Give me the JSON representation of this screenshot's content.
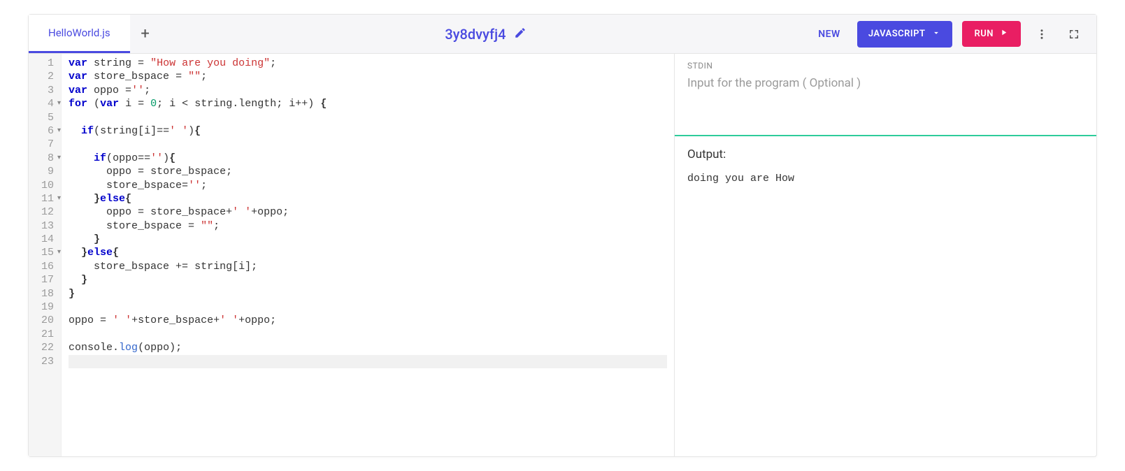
{
  "header": {
    "tabs": [
      {
        "label": "HelloWorld.js",
        "active": true
      }
    ],
    "project_id": "3y8dvyfj4",
    "new_label": "NEW",
    "language_label": "JAVASCRIPT",
    "run_label": "RUN"
  },
  "editor": {
    "lines": [
      {
        "n": 1,
        "fold": false,
        "tokens": [
          [
            "kw",
            "var"
          ],
          [
            "op",
            " string "
          ],
          [
            "op",
            "="
          ],
          [
            "op",
            " "
          ],
          [
            "str",
            "\"How are you doing\""
          ],
          [
            "punc",
            ";"
          ]
        ]
      },
      {
        "n": 2,
        "fold": false,
        "tokens": [
          [
            "kw",
            "var"
          ],
          [
            "op",
            " store_bspace "
          ],
          [
            "op",
            "="
          ],
          [
            "op",
            " "
          ],
          [
            "str",
            "\"\""
          ],
          [
            "punc",
            ";"
          ]
        ]
      },
      {
        "n": 3,
        "fold": false,
        "tokens": [
          [
            "kw",
            "var"
          ],
          [
            "op",
            " oppo "
          ],
          [
            "op",
            "="
          ],
          [
            "str",
            "''"
          ],
          [
            "punc",
            ";"
          ]
        ]
      },
      {
        "n": 4,
        "fold": true,
        "tokens": [
          [
            "kw",
            "for"
          ],
          [
            "op",
            " "
          ],
          [
            "punc",
            "("
          ],
          [
            "kw",
            "var"
          ],
          [
            "op",
            " i "
          ],
          [
            "op",
            "="
          ],
          [
            "op",
            " "
          ],
          [
            "num",
            "0"
          ],
          [
            "punc",
            ";"
          ],
          [
            "op",
            " i "
          ],
          [
            "op",
            "<"
          ],
          [
            "op",
            " string"
          ],
          [
            "punc",
            "."
          ],
          [
            "op",
            "length"
          ],
          [
            "punc",
            ";"
          ],
          [
            "op",
            " i"
          ],
          [
            "op",
            "++"
          ],
          [
            "punc",
            ")"
          ],
          [
            "op",
            " "
          ],
          [
            "bold",
            "{"
          ]
        ]
      },
      {
        "n": 5,
        "fold": false,
        "tokens": []
      },
      {
        "n": 6,
        "fold": true,
        "tokens": [
          [
            "op",
            "  "
          ],
          [
            "kw",
            "if"
          ],
          [
            "punc",
            "("
          ],
          [
            "op",
            "string"
          ],
          [
            "punc",
            "["
          ],
          [
            "op",
            "i"
          ],
          [
            "punc",
            "]"
          ],
          [
            "op",
            "=="
          ],
          [
            "str",
            "' '"
          ],
          [
            "punc",
            ")"
          ],
          [
            "bold",
            "{"
          ]
        ]
      },
      {
        "n": 7,
        "fold": false,
        "tokens": []
      },
      {
        "n": 8,
        "fold": true,
        "tokens": [
          [
            "op",
            "    "
          ],
          [
            "kw",
            "if"
          ],
          [
            "punc",
            "("
          ],
          [
            "op",
            "oppo"
          ],
          [
            "op",
            "=="
          ],
          [
            "str",
            "''"
          ],
          [
            "punc",
            ")"
          ],
          [
            "bold",
            "{"
          ]
        ]
      },
      {
        "n": 9,
        "fold": false,
        "tokens": [
          [
            "op",
            "      oppo "
          ],
          [
            "op",
            "="
          ],
          [
            "op",
            " store_bspace"
          ],
          [
            "punc",
            ";"
          ]
        ]
      },
      {
        "n": 10,
        "fold": false,
        "tokens": [
          [
            "op",
            "      store_bspace"
          ],
          [
            "op",
            "="
          ],
          [
            "str",
            "''"
          ],
          [
            "punc",
            ";"
          ]
        ]
      },
      {
        "n": 11,
        "fold": true,
        "tokens": [
          [
            "op",
            "    "
          ],
          [
            "bold",
            "}"
          ],
          [
            "kw",
            "else"
          ],
          [
            "bold",
            "{"
          ]
        ]
      },
      {
        "n": 12,
        "fold": false,
        "tokens": [
          [
            "op",
            "      oppo "
          ],
          [
            "op",
            "="
          ],
          [
            "op",
            " store_bspace"
          ],
          [
            "op",
            "+"
          ],
          [
            "str",
            "' '"
          ],
          [
            "op",
            "+oppo"
          ],
          [
            "punc",
            ";"
          ]
        ]
      },
      {
        "n": 13,
        "fold": false,
        "tokens": [
          [
            "op",
            "      store_bspace "
          ],
          [
            "op",
            "="
          ],
          [
            "op",
            " "
          ],
          [
            "str",
            "\"\""
          ],
          [
            "punc",
            ";"
          ]
        ]
      },
      {
        "n": 14,
        "fold": false,
        "tokens": [
          [
            "op",
            "    "
          ],
          [
            "bold",
            "}"
          ]
        ]
      },
      {
        "n": 15,
        "fold": true,
        "tokens": [
          [
            "op",
            "  "
          ],
          [
            "bold",
            "}"
          ],
          [
            "kw",
            "else"
          ],
          [
            "bold",
            "{"
          ]
        ]
      },
      {
        "n": 16,
        "fold": false,
        "tokens": [
          [
            "op",
            "    store_bspace "
          ],
          [
            "op",
            "+="
          ],
          [
            "op",
            " string"
          ],
          [
            "punc",
            "["
          ],
          [
            "op",
            "i"
          ],
          [
            "punc",
            "]"
          ],
          [
            "punc",
            ";"
          ]
        ]
      },
      {
        "n": 17,
        "fold": false,
        "tokens": [
          [
            "op",
            "  "
          ],
          [
            "bold",
            "}"
          ]
        ]
      },
      {
        "n": 18,
        "fold": false,
        "tokens": [
          [
            "bold",
            "}"
          ]
        ]
      },
      {
        "n": 19,
        "fold": false,
        "tokens": []
      },
      {
        "n": 20,
        "fold": false,
        "tokens": [
          [
            "op",
            "oppo "
          ],
          [
            "op",
            "="
          ],
          [
            "op",
            " "
          ],
          [
            "str",
            "' '"
          ],
          [
            "op",
            "+store_bspace"
          ],
          [
            "op",
            "+"
          ],
          [
            "str",
            "' '"
          ],
          [
            "op",
            "+oppo"
          ],
          [
            "punc",
            ";"
          ]
        ]
      },
      {
        "n": 21,
        "fold": false,
        "tokens": []
      },
      {
        "n": 22,
        "fold": false,
        "tokens": [
          [
            "op",
            "console"
          ],
          [
            "punc",
            "."
          ],
          [
            "fn",
            "log"
          ],
          [
            "punc",
            "("
          ],
          [
            "op",
            "oppo"
          ],
          [
            "punc",
            ")"
          ],
          [
            "punc",
            ";"
          ]
        ]
      },
      {
        "n": 23,
        "fold": false,
        "active": true,
        "tokens": []
      }
    ]
  },
  "io": {
    "stdin_label": "STDIN",
    "stdin_placeholder": "Input for the program ( Optional )",
    "stdin_value": "",
    "output_label": "Output:",
    "output_text": "doing you are How"
  }
}
